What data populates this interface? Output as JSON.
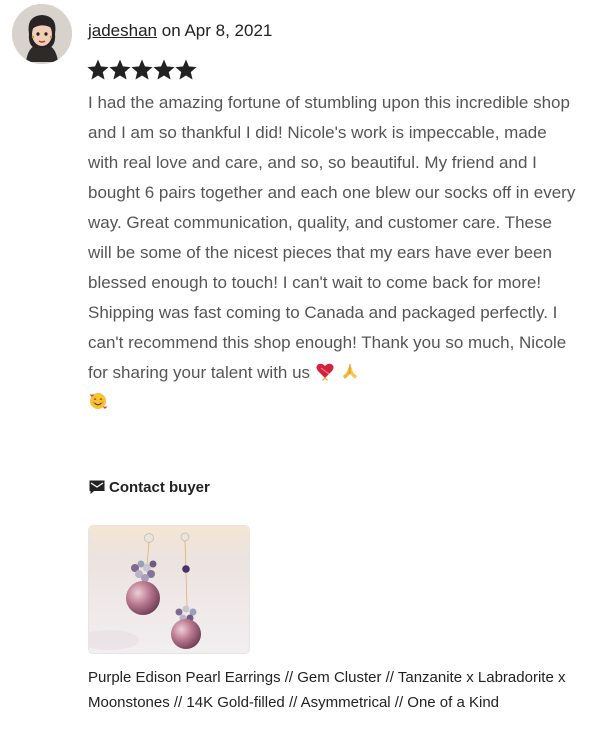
{
  "review": {
    "username": "jadeshan",
    "date_prefix": "on",
    "date": "Apr 8, 2021",
    "rating": 5,
    "rating_max": 5,
    "text": "I had the amazing fortune of stumbling upon this incredible shop and I am so thankful I did! Nicole's work is impeccable, made with real love and care, and so, so beautiful. My friend and I bought 6 pairs together and each one blew our socks off in every way. Great communication, quality, and customer care. These will be some of the nicest pieces that my ears have ever been blessed enough to touch! I can't wait to come back for more! Shipping was fast coming to Canada and packaged perfectly. I can't recommend this shop enough! Thank you so much, Nicole for sharing your talent with us",
    "emojis": [
      "heart-with-ribbon-emoji",
      "folded-hands-emoji",
      "smiling-face-with-hearts-emoji"
    ]
  },
  "actions": {
    "contact_label": "Contact buyer",
    "contact_icon": "message-icon"
  },
  "listing": {
    "image_icon": "pearl-earrings-photo",
    "title": "Purple Edison Pearl Earrings // Gem Cluster // Tanzanite x Labradorite x Moonstones // 14K Gold-filled // Asymmetrical // One of a Kind"
  },
  "colors": {
    "text_primary": "#222222",
    "text_review": "#555555",
    "star": "#222222"
  }
}
